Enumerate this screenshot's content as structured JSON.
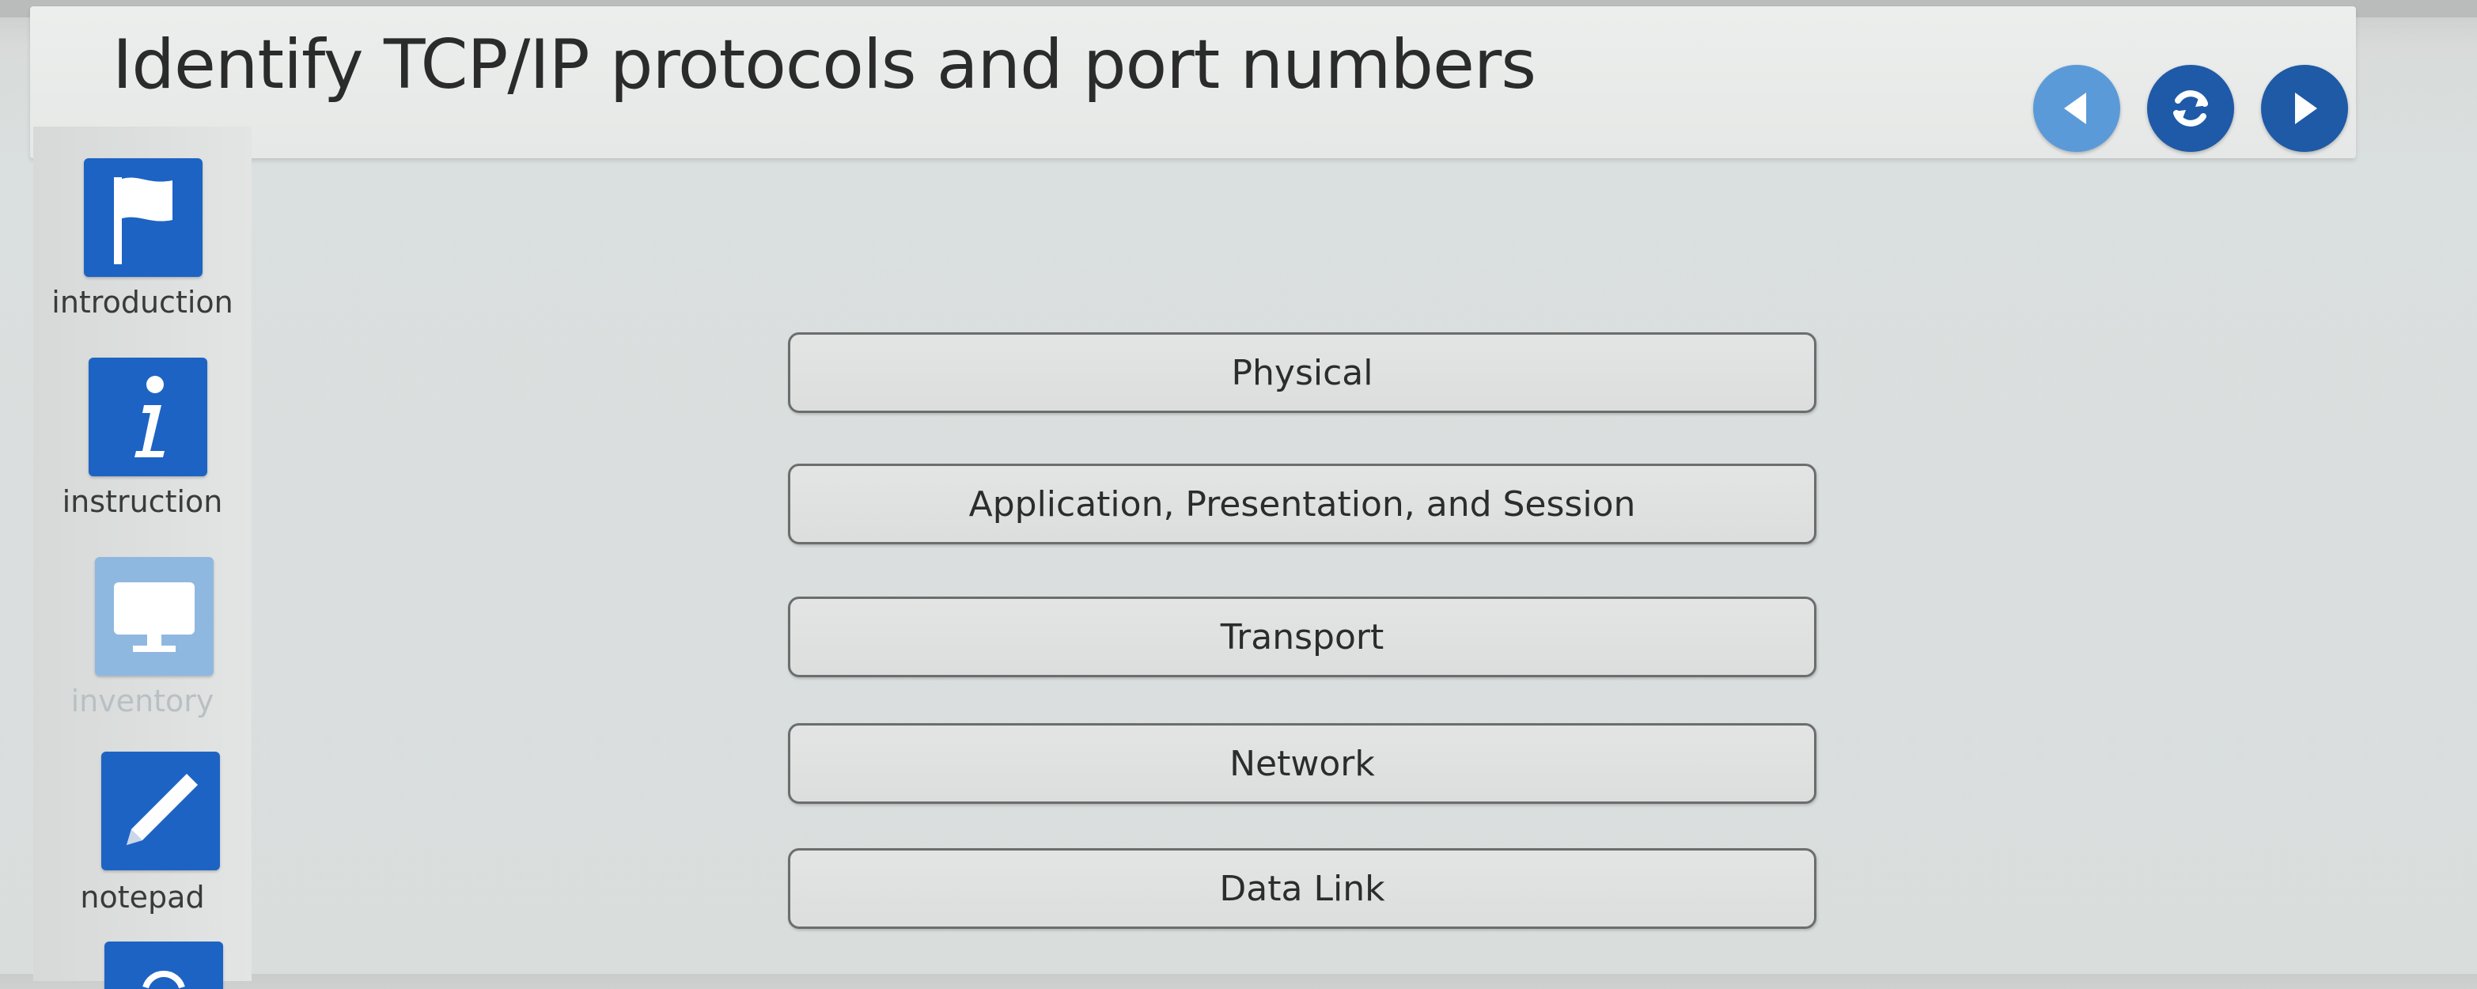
{
  "header": {
    "title": "Identify TCP/IP protocols and port numbers",
    "nav": {
      "prev_icon": "back-arrow-icon",
      "reset_icon": "refresh-icon",
      "next_icon": "forward-arrow-icon"
    }
  },
  "sidebar": {
    "items": [
      {
        "label": "introduction",
        "icon": "flag-icon",
        "enabled": true
      },
      {
        "label": "instruction",
        "icon": "info-icon",
        "enabled": true
      },
      {
        "label": "inventory",
        "icon": "monitor-icon",
        "enabled": false
      },
      {
        "label": "notepad",
        "icon": "pencil-icon",
        "enabled": true
      }
    ]
  },
  "main": {
    "layers": [
      {
        "label": "Physical"
      },
      {
        "label": "Application, Presentation, and Session"
      },
      {
        "label": "Transport"
      },
      {
        "label": "Network"
      },
      {
        "label": "Data Link"
      }
    ]
  },
  "colors": {
    "accent": "#1d63c4",
    "nav_prev": "#5b9ad8",
    "nav_active": "#1f5aa8",
    "disabled_tile": "#8fb8e0"
  }
}
